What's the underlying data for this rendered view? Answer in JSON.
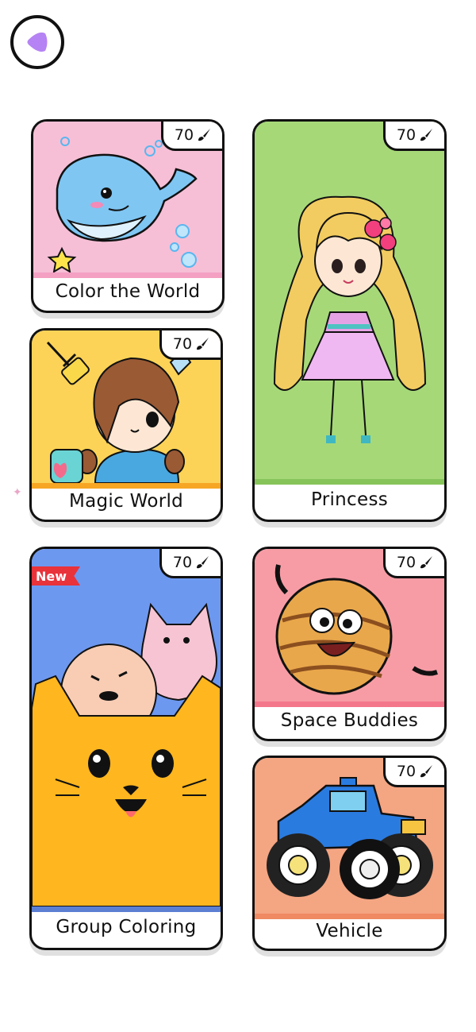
{
  "header": {
    "back_icon": "play-back-icon"
  },
  "cards": [
    {
      "label": "Color the World",
      "count": "70",
      "bg": "#f6bfd6"
    },
    {
      "label": "Magic World",
      "count": "70",
      "bg": "#fcd357"
    },
    {
      "label": "Princess",
      "count": "70",
      "bg": "#a6d878"
    },
    {
      "label": "Group Coloring",
      "count": "70",
      "bg": "#6d98f0",
      "tag": "New"
    },
    {
      "label": "Space Buddies",
      "count": "70",
      "bg": "#f79ca5"
    },
    {
      "label": "Vehicle",
      "count": "70",
      "bg": "#f4a582"
    }
  ],
  "badge_icon": "paintbrush-icon"
}
